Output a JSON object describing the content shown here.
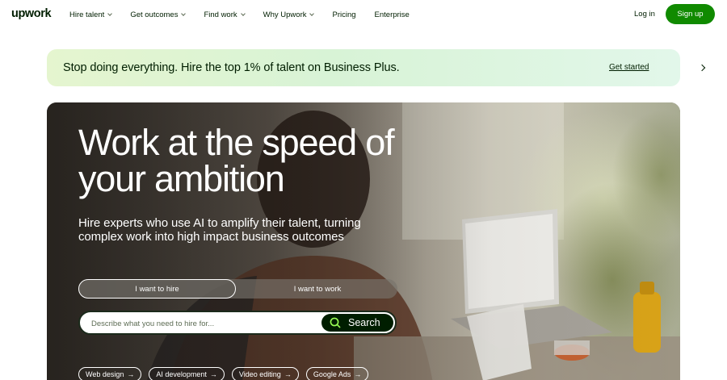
{
  "header": {
    "logo": "upwork",
    "nav": [
      {
        "label": "Hire talent",
        "has_dropdown": true
      },
      {
        "label": "Get outcomes",
        "has_dropdown": true
      },
      {
        "label": "Find work",
        "has_dropdown": true
      },
      {
        "label": "Why Upwork",
        "has_dropdown": true
      },
      {
        "label": "Pricing",
        "has_dropdown": false
      },
      {
        "label": "Enterprise",
        "has_dropdown": false
      }
    ],
    "login_label": "Log in",
    "signup_label": "Sign up"
  },
  "promo": {
    "text": "Stop doing everything. Hire the top 1% of talent on Business Plus.",
    "link_label": "Get started",
    "arrow_icon": "chevron-right-icon"
  },
  "hero": {
    "title": "Work at the speed of your ambition",
    "subtitle": "Hire experts who use AI to amplify their talent, turning complex work into high impact business outcomes",
    "toggle": {
      "hire_label": "I want to hire",
      "work_label": "I want to work",
      "selected": "hire"
    },
    "search": {
      "placeholder": "Describe what you need to hire for...",
      "value": "",
      "button_label": "Search",
      "icon": "search-icon"
    },
    "chips": [
      {
        "label": "Web design",
        "icon": "arrow-right-icon"
      },
      {
        "label": "AI development",
        "icon": "arrow-right-icon"
      },
      {
        "label": "Video editing",
        "icon": "arrow-right-icon"
      },
      {
        "label": "Google Ads",
        "icon": "arrow-right-icon"
      }
    ]
  },
  "colors": {
    "brand_green": "#108a00",
    "text_dark": "#001e00",
    "search_icon_ring": "#9aff55",
    "promo_bg": "#dff5d8"
  }
}
